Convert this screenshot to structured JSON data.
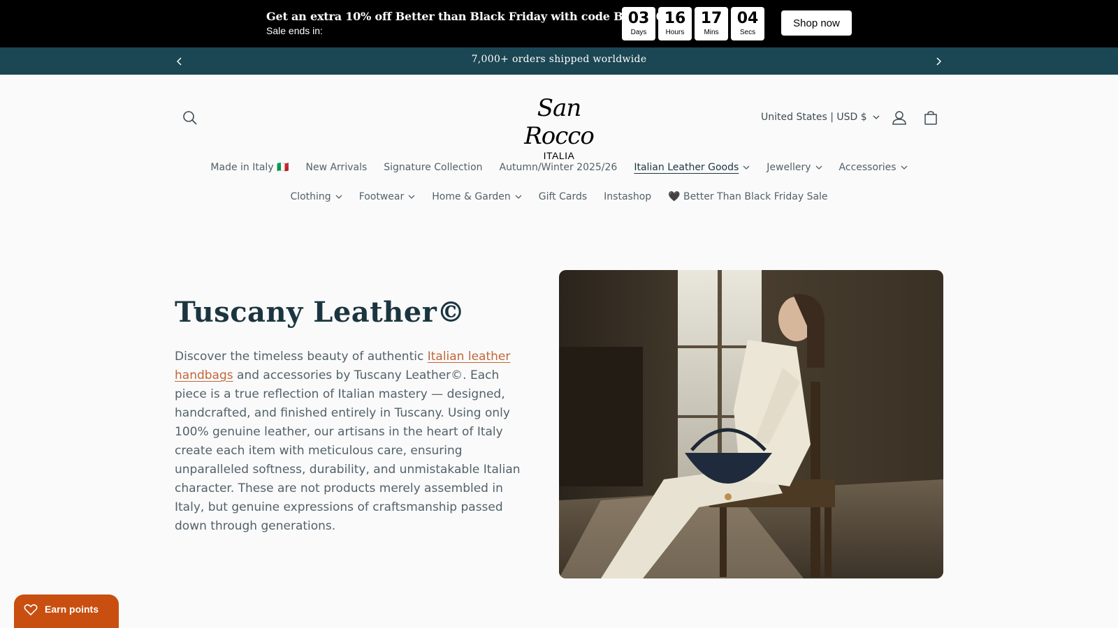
{
  "promo": {
    "headline": "Get an extra 10% off Better than Black Friday with code BTBF10",
    "sub": "Sale ends in:",
    "countdown": [
      {
        "value": "03",
        "label": "Days"
      },
      {
        "value": "16",
        "label": "Hours"
      },
      {
        "value": "17",
        "label": "Mins"
      },
      {
        "value": "04",
        "label": "Secs"
      }
    ],
    "button": "Shop now"
  },
  "announcement": {
    "text": "7,000+ orders shipped worldwide"
  },
  "header": {
    "logo_script": "San Rocco",
    "logo_sub": "ITALIA",
    "locale": "United States | USD $"
  },
  "nav": {
    "row1": [
      {
        "label": "Made in Italy 🇮🇹",
        "dropdown": false
      },
      {
        "label": "New Arrivals",
        "dropdown": false
      },
      {
        "label": "Signature Collection",
        "dropdown": false
      },
      {
        "label": "Autumn/Winter 2025/26",
        "dropdown": false
      },
      {
        "label": "Italian Leather Goods",
        "dropdown": true
      },
      {
        "label": "Jewellery",
        "dropdown": true
      },
      {
        "label": "Accessories",
        "dropdown": true
      }
    ],
    "row2": [
      {
        "label": "Clothing",
        "dropdown": true
      },
      {
        "label": "Footwear",
        "dropdown": true
      },
      {
        "label": "Home & Garden",
        "dropdown": true
      },
      {
        "label": "Gift Cards",
        "dropdown": false
      },
      {
        "label": "Instashop",
        "dropdown": false
      },
      {
        "label": "🖤 Better Than Black Friday Sale",
        "dropdown": false
      }
    ]
  },
  "hero": {
    "title": "Tuscany Leather©",
    "body_pre": "Discover the timeless beauty of authentic ",
    "body_link": "Italian leather handbags",
    "body_post": " and accessories by Tuscany Leather©. Each piece is a true reflection of Italian mastery — designed, handcrafted, and finished entirely in Tuscany. Using only 100% genuine leather, our artisans in the heart of Italy create each item with meticulous care, ensuring unparalleled softness, durability, and unmistakable Italian character. These are not products merely assembled in Italy, but genuine expressions of craftsmanship passed down through generations."
  },
  "rewards": {
    "label": "Earn points"
  },
  "colors": {
    "promo_bg": "#000000",
    "announcement_bg": "#1b4653",
    "link": "#c0663a",
    "rewards_bg": "#c84f10"
  }
}
